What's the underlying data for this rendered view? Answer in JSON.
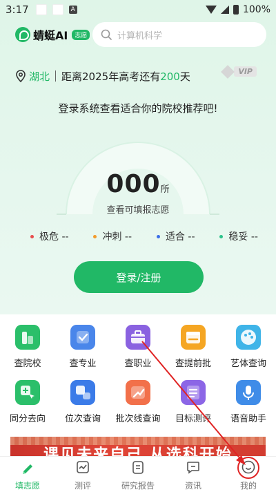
{
  "status_bar": {
    "time": "3:17",
    "notification_icon": "A",
    "battery": "100%"
  },
  "header": {
    "logo_text": "蜻蜓AI",
    "logo_badge": "志愿",
    "search_placeholder": "计算机科学"
  },
  "location": {
    "province": "湖北",
    "countdown_prefix": "距离2025年高考还有",
    "countdown_days": "200",
    "countdown_suffix": "天",
    "vip_label": "VIP"
  },
  "prompt": "登录系统查看适合你的院校推荐吧!",
  "gauge": {
    "count": "000",
    "unit": "所",
    "label": "查看可填报志愿"
  },
  "legend": [
    {
      "label": "极危 --",
      "color": "#e84d4d"
    },
    {
      "label": "冲刺 --",
      "color": "#f39a2b"
    },
    {
      "label": "适合 --",
      "color": "#3b6ee8"
    },
    {
      "label": "稳妥 --",
      "color": "#2bc28a"
    }
  ],
  "login_button": "登录/注册",
  "tools": [
    {
      "label": "查院校",
      "icon": "school-icon",
      "color": "#2bbf6a"
    },
    {
      "label": "查专业",
      "icon": "major-icon",
      "color": "#4a86ea"
    },
    {
      "label": "查职业",
      "icon": "briefcase-icon",
      "color": "#8a62e0"
    },
    {
      "label": "查提前批",
      "icon": "calendar-icon",
      "color": "#f5a623"
    },
    {
      "label": "艺体查询",
      "icon": "palette-icon",
      "color": "#3fb4e8"
    },
    {
      "label": "同分去向",
      "icon": "direction-icon",
      "color": "#2bbf6a"
    },
    {
      "label": "位次查询",
      "icon": "rank-icon",
      "color": "#3b7be8"
    },
    {
      "label": "批次线查询",
      "icon": "trend-icon",
      "color": "#f2704a"
    },
    {
      "label": "目标测评",
      "icon": "target-icon",
      "color": "#8c66e6"
    },
    {
      "label": "语音助手",
      "icon": "microphone-icon",
      "color": "#3f8ce8"
    }
  ],
  "banner": {
    "text": "课见未来自己 从选科开始"
  },
  "bottom_nav": [
    {
      "label": "填志愿",
      "icon": "pencil-icon",
      "active": true
    },
    {
      "label": "测评",
      "icon": "chart-icon",
      "active": false
    },
    {
      "label": "研究报告",
      "icon": "report-icon",
      "active": false
    },
    {
      "label": "资讯",
      "icon": "message-icon",
      "active": false
    },
    {
      "label": "我的",
      "icon": "profile-icon",
      "active": false
    }
  ],
  "colors": {
    "brand": "#21b866",
    "annotation": "#e02424"
  }
}
